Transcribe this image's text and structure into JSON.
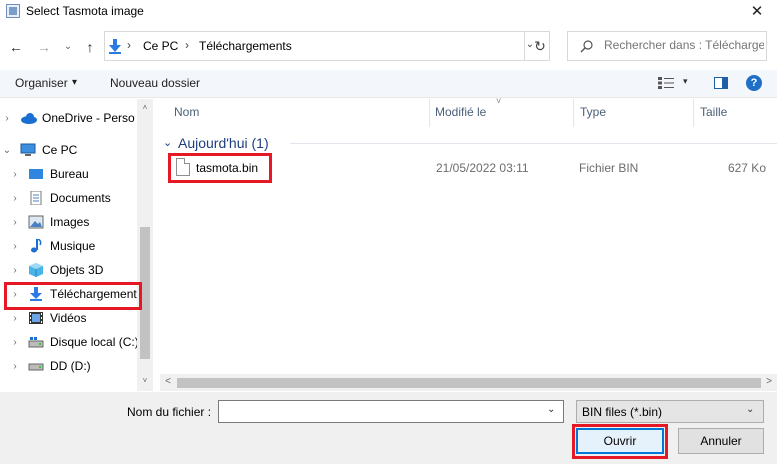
{
  "window": {
    "title": "Select Tasmota image",
    "close_icon": "✕"
  },
  "nav": {
    "back_icon": "←",
    "forward_icon": "→",
    "recent_icon": "⌄",
    "up_icon": "↑",
    "breadcrumb": [
      "Ce PC",
      "Téléchargements"
    ],
    "separator": "›",
    "refresh_icon": "↻",
    "search_placeholder": "Rechercher dans : Téléchargements"
  },
  "toolbar": {
    "organize_label": "Organiser",
    "organize_caret": "▾",
    "new_folder_label": "Nouveau dossier",
    "view_caret": "▾",
    "help_label": "?"
  },
  "sidebar": {
    "items": [
      {
        "label": "OneDrive - Perso",
        "icon": "cloud-icon",
        "chevron": "›"
      },
      {
        "label": "Ce PC",
        "icon": "computer-icon",
        "chevron": "⌄"
      },
      {
        "label": "Bureau",
        "icon": "desktop-icon",
        "chevron": "›"
      },
      {
        "label": "Documents",
        "icon": "document-icon",
        "chevron": "›"
      },
      {
        "label": "Images",
        "icon": "pictures-icon",
        "chevron": "›"
      },
      {
        "label": "Musique",
        "icon": "music-icon",
        "chevron": "›"
      },
      {
        "label": "Objets 3D",
        "icon": "cube-icon",
        "chevron": "›"
      },
      {
        "label": "Téléchargements",
        "icon": "download-icon",
        "chevron": "›"
      },
      {
        "label": "Vidéos",
        "icon": "video-icon",
        "chevron": "›"
      },
      {
        "label": "Disque local (C:)",
        "icon": "drive-icon",
        "chevron": "›"
      },
      {
        "label": "DD (D:)",
        "icon": "drive-icon",
        "chevron": "›"
      }
    ]
  },
  "file_list": {
    "columns": [
      "Nom",
      "Modifié le",
      "Type",
      "Taille"
    ],
    "group": {
      "title": "Aujourd'hui (1)",
      "chevron": "⌄"
    },
    "rows": [
      {
        "name": "tasmota.bin",
        "modified": "21/05/2022 03:11",
        "type": "Fichier BIN",
        "size": "627 Ko"
      }
    ]
  },
  "bottom": {
    "filename_label": "Nom du fichier :",
    "filename_value": "",
    "filter_value": "BIN files (*.bin)",
    "dropdown_caret": "⌄",
    "open_label": "Ouvrir",
    "cancel_label": "Annuler"
  },
  "scroll": {
    "up": "˄",
    "down": "˅",
    "left": "<",
    "right": ">"
  },
  "colors": {
    "highlight": "#e51926",
    "accent": "#0078d7",
    "group_text": "#1e3e80"
  }
}
